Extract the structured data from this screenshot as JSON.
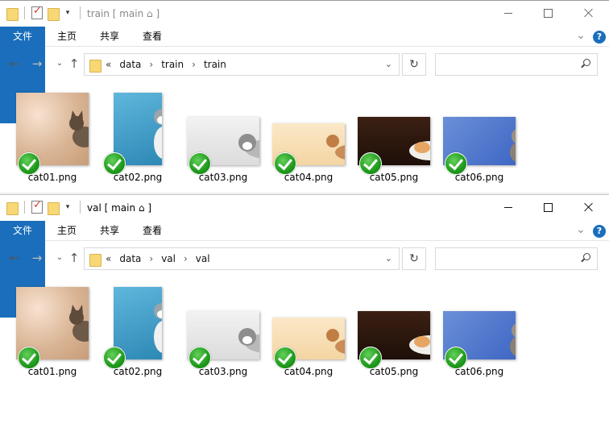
{
  "windows": [
    {
      "title": "train [ main ⌂ ]",
      "ribbon": {
        "file": "文件",
        "home": "主页",
        "share": "共享",
        "view": "查看",
        "help": "?"
      },
      "address": {
        "overflow": "«",
        "crumbs": [
          "data",
          "train",
          "train"
        ]
      },
      "search": {
        "placeholder": ""
      },
      "files": [
        "cat01.png",
        "cat02.png",
        "cat03.png",
        "cat04.png",
        "cat05.png",
        "cat06.png"
      ]
    },
    {
      "title": "val [ main ⌂ ]",
      "ribbon": {
        "file": "文件",
        "home": "主页",
        "share": "共享",
        "view": "查看",
        "help": "?"
      },
      "address": {
        "overflow": "«",
        "crumbs": [
          "data",
          "val",
          "val"
        ]
      },
      "search": {
        "placeholder": ""
      },
      "files": [
        "cat01.png",
        "cat02.png",
        "cat03.png",
        "cat04.png",
        "cat05.png",
        "cat06.png"
      ]
    }
  ],
  "icons": {
    "back": "arrow-left-icon",
    "forward": "arrow-right-icon",
    "recent": "chevron-down-icon",
    "up": "arrow-up-icon",
    "refresh": "refresh-icon",
    "search": "search-icon",
    "status": "green-check-overlay-icon"
  },
  "colors": {
    "ribbon_file_tab": "#1a6ebb",
    "check_green": "#1f9a1c",
    "folder_yellow": "#f8d775"
  }
}
